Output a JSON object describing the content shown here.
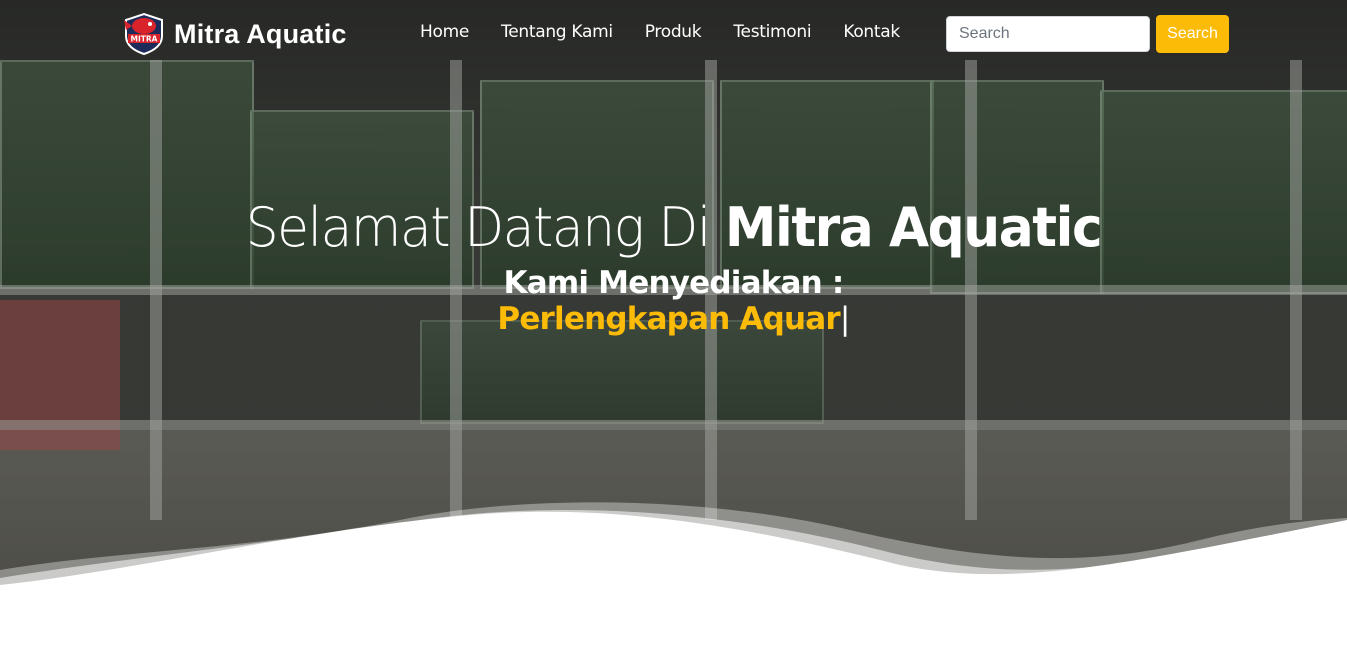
{
  "brand": {
    "name": "Mitra Aquatic",
    "logo_text": "MITRA"
  },
  "nav": {
    "items": [
      {
        "label": "Home"
      },
      {
        "label": "Tentang Kami"
      },
      {
        "label": "Produk"
      },
      {
        "label": "Testimoni"
      },
      {
        "label": "Kontak"
      }
    ]
  },
  "search": {
    "placeholder": "Search",
    "button_label": "Search"
  },
  "hero": {
    "title_prefix": "Selamat Datang Di ",
    "title_brand": "Mitra Aquatic",
    "subtitle": "Kami Menyediakan :",
    "typed_text": "Perlengkapan Aquar",
    "cursor": "|"
  },
  "colors": {
    "accent": "#fcbb06",
    "text_light": "#ffffff",
    "logo_red": "#d8232a",
    "logo_navy": "#1c2b5a"
  }
}
